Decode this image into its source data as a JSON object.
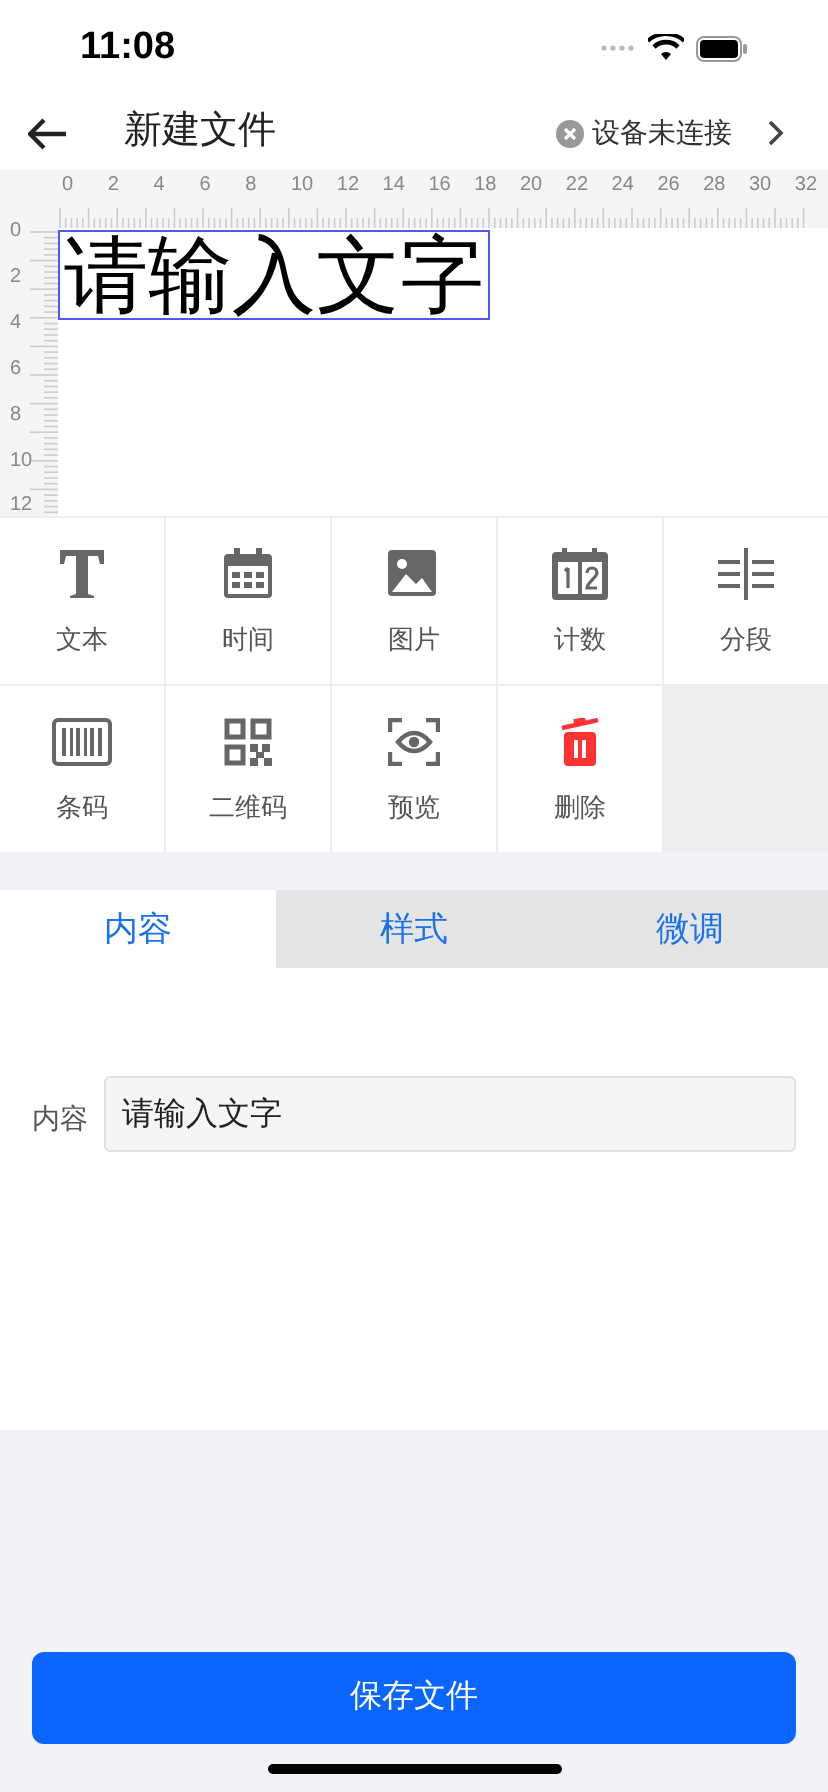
{
  "status_bar": {
    "time": "11:08"
  },
  "header": {
    "title": "新建文件",
    "device_status": "设备未连接"
  },
  "canvas": {
    "x_ruler": [
      "0",
      "2",
      "4",
      "6",
      "8",
      "10",
      "12",
      "14",
      "16",
      "18",
      "20",
      "22",
      "24",
      "26",
      "28",
      "30",
      "32"
    ],
    "y_ruler": [
      "0",
      "2",
      "4",
      "6",
      "8",
      "10",
      "12"
    ],
    "text_element": {
      "text": "请输入文字",
      "selected": true
    }
  },
  "tools": [
    {
      "kind": "text",
      "label": "文本"
    },
    {
      "kind": "time",
      "label": "时间"
    },
    {
      "kind": "image",
      "label": "图片"
    },
    {
      "kind": "counter",
      "label": "计数"
    },
    {
      "kind": "divider",
      "label": "分段"
    },
    {
      "kind": "barcode",
      "label": "条码"
    },
    {
      "kind": "qrcode",
      "label": "二维码"
    },
    {
      "kind": "preview",
      "label": "预览"
    },
    {
      "kind": "delete",
      "label": "删除"
    }
  ],
  "tabs": [
    {
      "label": "内容",
      "selected": true
    },
    {
      "label": "样式",
      "selected": false
    },
    {
      "label": "微调",
      "selected": false
    }
  ],
  "content": {
    "label": "内容",
    "value": "请输入文字"
  },
  "save_button": "保存文件"
}
